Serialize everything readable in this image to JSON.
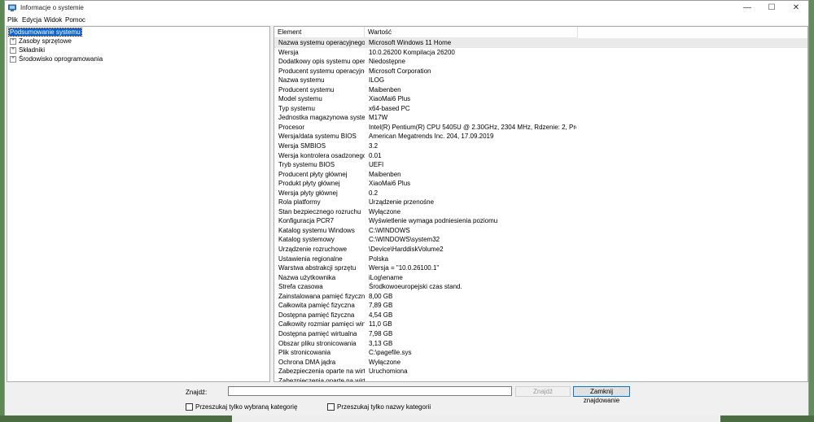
{
  "window": {
    "title": "Informacje o systemie"
  },
  "window_controls": {
    "minimize": "—",
    "maximize": "☐",
    "close": "✕"
  },
  "menu": [
    {
      "label": "Plik"
    },
    {
      "label": "Edycja"
    },
    {
      "label": "Widok"
    },
    {
      "label": "Pomoc"
    }
  ],
  "tree": [
    {
      "label": "Podsumowanie systemu",
      "expandable": false,
      "selected": true
    },
    {
      "label": "Zasoby sprzętowe",
      "expandable": true,
      "selected": false
    },
    {
      "label": "Składniki",
      "expandable": true,
      "selected": false
    },
    {
      "label": "Środowisko oprogramowania",
      "expandable": true,
      "selected": false
    }
  ],
  "list": {
    "columns": [
      "Element",
      "Wartość"
    ],
    "rows": [
      {
        "element": "Nazwa systemu operacyjnego",
        "value": "Microsoft Windows 11 Home"
      },
      {
        "element": "Wersja",
        "value": "10.0.26200 Kompilacja 26200"
      },
      {
        "element": "Dodatkowy opis systemu oper...",
        "value": "Niedostępne"
      },
      {
        "element": "Producent systemu operacyjne...",
        "value": "Microsoft Corporation"
      },
      {
        "element": "Nazwa systemu",
        "value": "ILOG"
      },
      {
        "element": "Producent systemu",
        "value": "Maibenben"
      },
      {
        "element": "Model systemu",
        "value": "XiaoMai6 Plus"
      },
      {
        "element": "Typ systemu",
        "value": "x64-based PC"
      },
      {
        "element": "Jednostka magazynowa systemu",
        "value": "M17W"
      },
      {
        "element": "Procesor",
        "value": "Intel(R) Pentium(R) CPU 5405U @ 2.30GHz, 2304 MHz, Rdzenie: 2, Procesory l..."
      },
      {
        "element": "Wersja/data systemu BIOS",
        "value": "American Megatrends Inc. 204, 17.09.2019"
      },
      {
        "element": "Wersja SMBIOS",
        "value": "3.2"
      },
      {
        "element": "Wersja kontrolera osadzonego",
        "value": "0.01"
      },
      {
        "element": "Tryb systemu BIOS",
        "value": "UEFI"
      },
      {
        "element": "Producent płyty głównej",
        "value": "Maibenben"
      },
      {
        "element": "Produkt płyty głównej",
        "value": "XiaoMai6 Plus"
      },
      {
        "element": "Wersja płyty głównej",
        "value": "0.2"
      },
      {
        "element": "Rola platformy",
        "value": "Urządzenie przenośne"
      },
      {
        "element": "Stan bezpiecznego rozruchu",
        "value": "Wyłączone"
      },
      {
        "element": "Konfiguracja PCR7",
        "value": "Wyświetlenie wymaga podniesienia poziomu"
      },
      {
        "element": "Katalog systemu Windows",
        "value": "C:\\WINDOWS"
      },
      {
        "element": "Katalog systemowy",
        "value": "C:\\WINDOWS\\system32"
      },
      {
        "element": "Urządzenie rozruchowe",
        "value": "\\Device\\HarddiskVolume2"
      },
      {
        "element": "Ustawienia regionalne",
        "value": "Polska"
      },
      {
        "element": "Warstwa abstrakcji sprzętu",
        "value": "Wersja = \"10.0.26100.1\""
      },
      {
        "element": "Nazwa użytkownika",
        "value": "iLog\\ename"
      },
      {
        "element": "Strefa czasowa",
        "value": "Środkowoeuropejski czas stand."
      },
      {
        "element": "Zainstalowana pamięć fizyczna ...",
        "value": "8,00 GB"
      },
      {
        "element": "Całkowita pamięć fizyczna",
        "value": "7,89 GB"
      },
      {
        "element": "Dostępna pamięć fizyczna",
        "value": "4,54 GB"
      },
      {
        "element": "Całkowity rozmiar pamięci wirt...",
        "value": "11,0 GB"
      },
      {
        "element": "Dostępna pamięć wirtualna",
        "value": "7,98 GB"
      },
      {
        "element": "Obszar pliku stronicowania",
        "value": "3,13 GB"
      },
      {
        "element": "Plik stronicowania",
        "value": "C:\\pagefile.sys"
      },
      {
        "element": "Ochrona DMA jądra",
        "value": "Wyłączone"
      },
      {
        "element": "Zabezpieczenia oparte na wirtu...",
        "value": "Uruchomiona"
      },
      {
        "element": "Zabezpieczenia oparte na wirtu...",
        "value": ""
      }
    ]
  },
  "find": {
    "label": "Znajdź:",
    "value": "",
    "find_button": "Znajdź",
    "close_button": "Zamknij znajdowanie",
    "option_selected_category": "Przeszukaj tylko wybraną kategorię",
    "option_category_names": "Przeszukaj tylko nazwy kategorii"
  }
}
